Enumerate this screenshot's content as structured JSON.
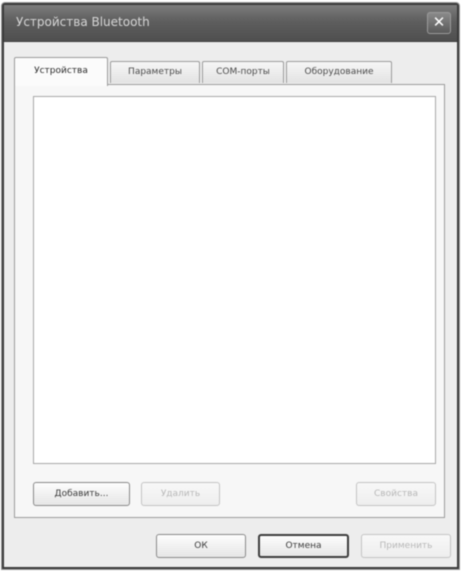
{
  "window": {
    "title": "Устройства Bluetooth",
    "close_glyph": "✕"
  },
  "tabs": [
    {
      "label": "Устройства",
      "active": true
    },
    {
      "label": "Параметры",
      "active": false
    },
    {
      "label": "COM-порты",
      "active": false
    },
    {
      "label": "Оборудование",
      "active": false
    }
  ],
  "device_panel": {
    "add_label": "Добавить...",
    "remove_label": "Удалить",
    "properties_label": "Свойства"
  },
  "footer": {
    "ok_label": "ОК",
    "cancel_label": "Отмена",
    "apply_label": "Применить"
  }
}
